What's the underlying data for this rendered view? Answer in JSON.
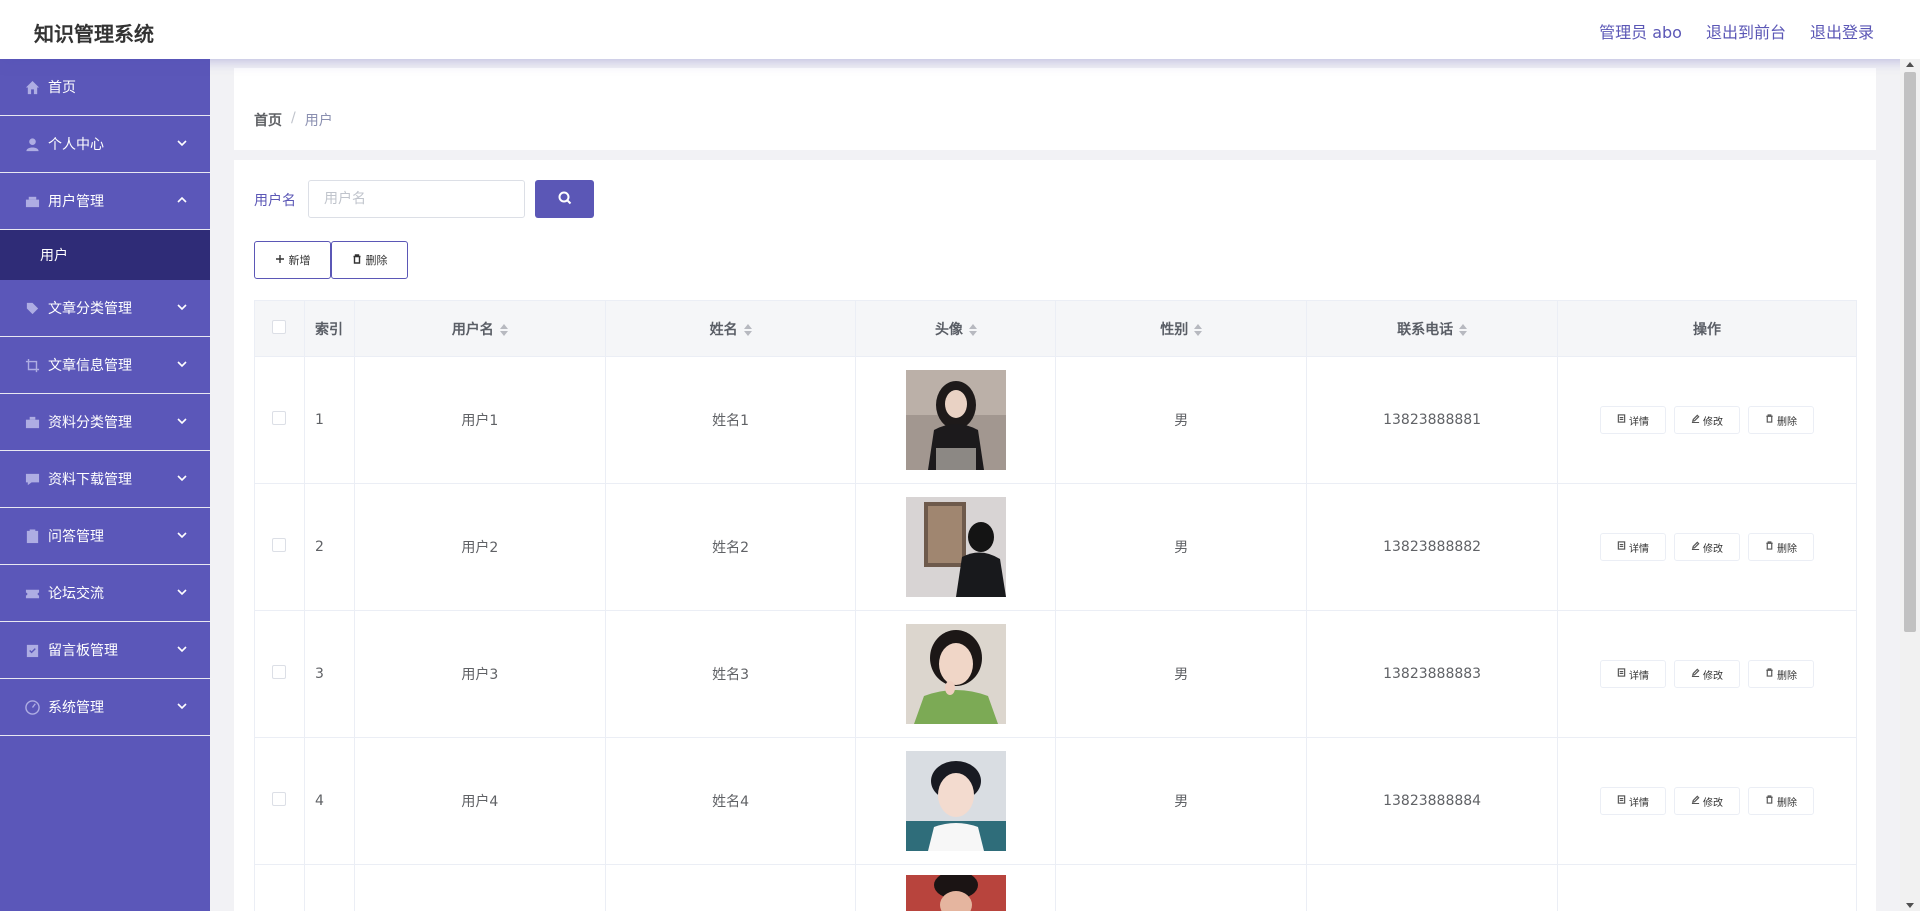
{
  "header": {
    "title": "知识管理系统",
    "admin": "管理员 abo",
    "exit_front": "退出到前台",
    "logout": "退出登录"
  },
  "sidebar": {
    "items": [
      {
        "label": "首页",
        "icon": "home-icon"
      },
      {
        "label": "个人中心",
        "icon": "user-icon"
      },
      {
        "label": "用户管理",
        "icon": "users-icon"
      },
      {
        "label": "文章分类管理",
        "icon": "tag-icon"
      },
      {
        "label": "文章信息管理",
        "icon": "crop-icon"
      },
      {
        "label": "资料分类管理",
        "icon": "briefcase-icon"
      },
      {
        "label": "资料下载管理",
        "icon": "message-icon"
      },
      {
        "label": "问答管理",
        "icon": "clipboard-icon"
      },
      {
        "label": "论坛交流",
        "icon": "ticket-icon"
      },
      {
        "label": "留言板管理",
        "icon": "note-icon"
      },
      {
        "label": "系统管理",
        "icon": "gauge-icon"
      }
    ],
    "active_sub": "用户"
  },
  "breadcrumb": {
    "home": "首页",
    "sep": "/",
    "current": "用户"
  },
  "search": {
    "label": "用户名",
    "placeholder": "用户名"
  },
  "actions": {
    "add": "新增",
    "delete": "删除"
  },
  "table": {
    "headers": {
      "index": "索引",
      "username": "用户名",
      "name": "姓名",
      "avatar": "头像",
      "gender": "性别",
      "phone": "联系电话",
      "ops": "操作"
    },
    "ops_labels": {
      "detail": "详情",
      "edit": "修改",
      "delete": "删除"
    },
    "rows": [
      {
        "index": "1",
        "username": "用户1",
        "name": "姓名1",
        "gender": "男",
        "phone": "13823888881"
      },
      {
        "index": "2",
        "username": "用户2",
        "name": "姓名2",
        "gender": "男",
        "phone": "13823888882"
      },
      {
        "index": "3",
        "username": "用户3",
        "name": "姓名3",
        "gender": "男",
        "phone": "13823888883"
      },
      {
        "index": "4",
        "username": "用户4",
        "name": "姓名4",
        "gender": "男",
        "phone": "13823888884"
      }
    ]
  },
  "colors": {
    "accent": "#5b57b6",
    "sidebar": "#5b57b9",
    "sidebar_active": "#2f2c77"
  }
}
